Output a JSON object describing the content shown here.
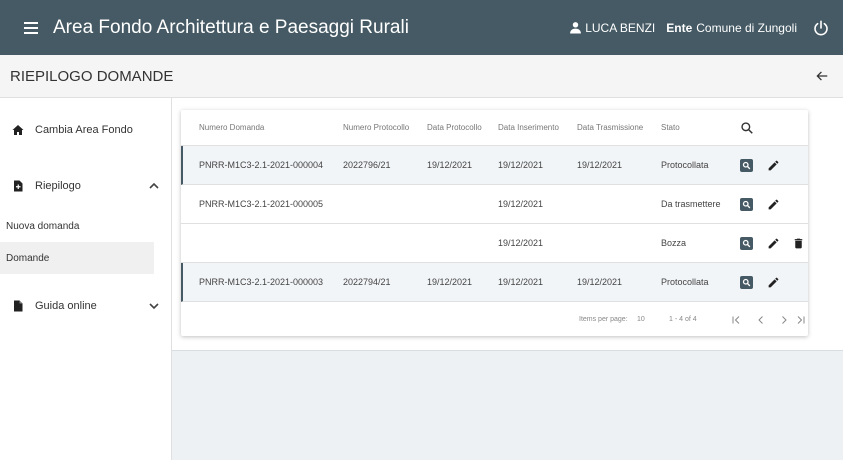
{
  "header": {
    "title": "Area Fondo Architettura e Paesaggi Rurali",
    "user_name": "LUCA BENZI",
    "ente_label": "Ente",
    "ente_value": "Comune di Zungoli"
  },
  "subheader": {
    "title": "RIEPILOGO DOMANDE"
  },
  "sidebar": {
    "home_label": "Cambia Area Fondo",
    "riepilogo_label": "Riepilogo",
    "nuova_label": "Nuova domanda",
    "domande_label": "Domande",
    "guida_label": "Guida online"
  },
  "table": {
    "columns": [
      "Numero Domanda",
      "Numero Protocollo",
      "Data Protocollo",
      "Data Inserimento",
      "Data Trasmissione",
      "Stato"
    ],
    "rows": [
      {
        "numero": "PNRR-M1C3-2.1-2021-000004",
        "protocollo": "2022796/21",
        "data_protocollo": "19/12/2021",
        "data_inserimento": "19/12/2021",
        "data_trasmissione": "19/12/2021",
        "stato": "Protocollata"
      },
      {
        "numero": "PNRR-M1C3-2.1-2021-000005",
        "protocollo": "",
        "data_protocollo": "",
        "data_inserimento": "19/12/2021",
        "data_trasmissione": "",
        "stato": "Da trasmettere"
      },
      {
        "numero": "",
        "protocollo": "",
        "data_protocollo": "",
        "data_inserimento": "19/12/2021",
        "data_trasmissione": "",
        "stato": "Bozza"
      },
      {
        "numero": "PNRR-M1C3-2.1-2021-000003",
        "protocollo": "2022794/21",
        "data_protocollo": "19/12/2021",
        "data_inserimento": "19/12/2021",
        "data_trasmissione": "19/12/2021",
        "stato": "Protocollata"
      }
    ]
  },
  "paginator": {
    "items_per_page_label": "Items per page:",
    "items_per_page": "10",
    "range": "1 - 4 of 4"
  },
  "colors": {
    "primary": "#455a64",
    "panel_bg": "#eef1f4"
  },
  "icons": [
    "menu-icon",
    "user-icon",
    "power-icon",
    "back-arrow-icon",
    "home-icon",
    "add-document-icon",
    "document-icon",
    "chevron-up-icon",
    "chevron-down-icon",
    "search-icon",
    "view-icon",
    "edit-icon",
    "delete-icon",
    "first-page-icon",
    "prev-page-icon",
    "next-page-icon",
    "last-page-icon"
  ]
}
